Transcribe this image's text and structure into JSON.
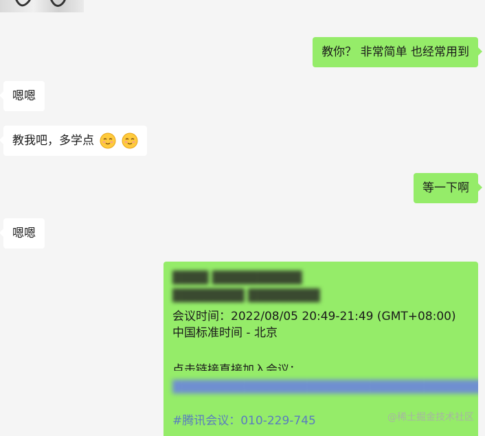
{
  "messages": [
    {
      "side": "right",
      "text": "教你？ 非常简单 也经常用到"
    },
    {
      "side": "left",
      "text": "嗯嗯"
    },
    {
      "side": "left",
      "text": "教我吧，多学点",
      "emojis": [
        "smiling-face-icon",
        "smiling-face-icon"
      ]
    },
    {
      "side": "right",
      "text": "等一下啊"
    },
    {
      "side": "left",
      "text": "嗯嗯"
    }
  ],
  "meeting_card": {
    "time_line": "会议时间：2022/08/05 20:49-21:49 (GMT+08:00)",
    "timezone_line": "中国标准时间 - 北京",
    "join_line": "点击链接直接加入会议：",
    "number_line": "#腾讯会议：010-229-745"
  },
  "watermark": "@稀土掘金技术社区",
  "colors": {
    "background": "#f5f5f5",
    "incoming_bubble": "#ffffff",
    "outgoing_bubble": "#95ec69"
  }
}
